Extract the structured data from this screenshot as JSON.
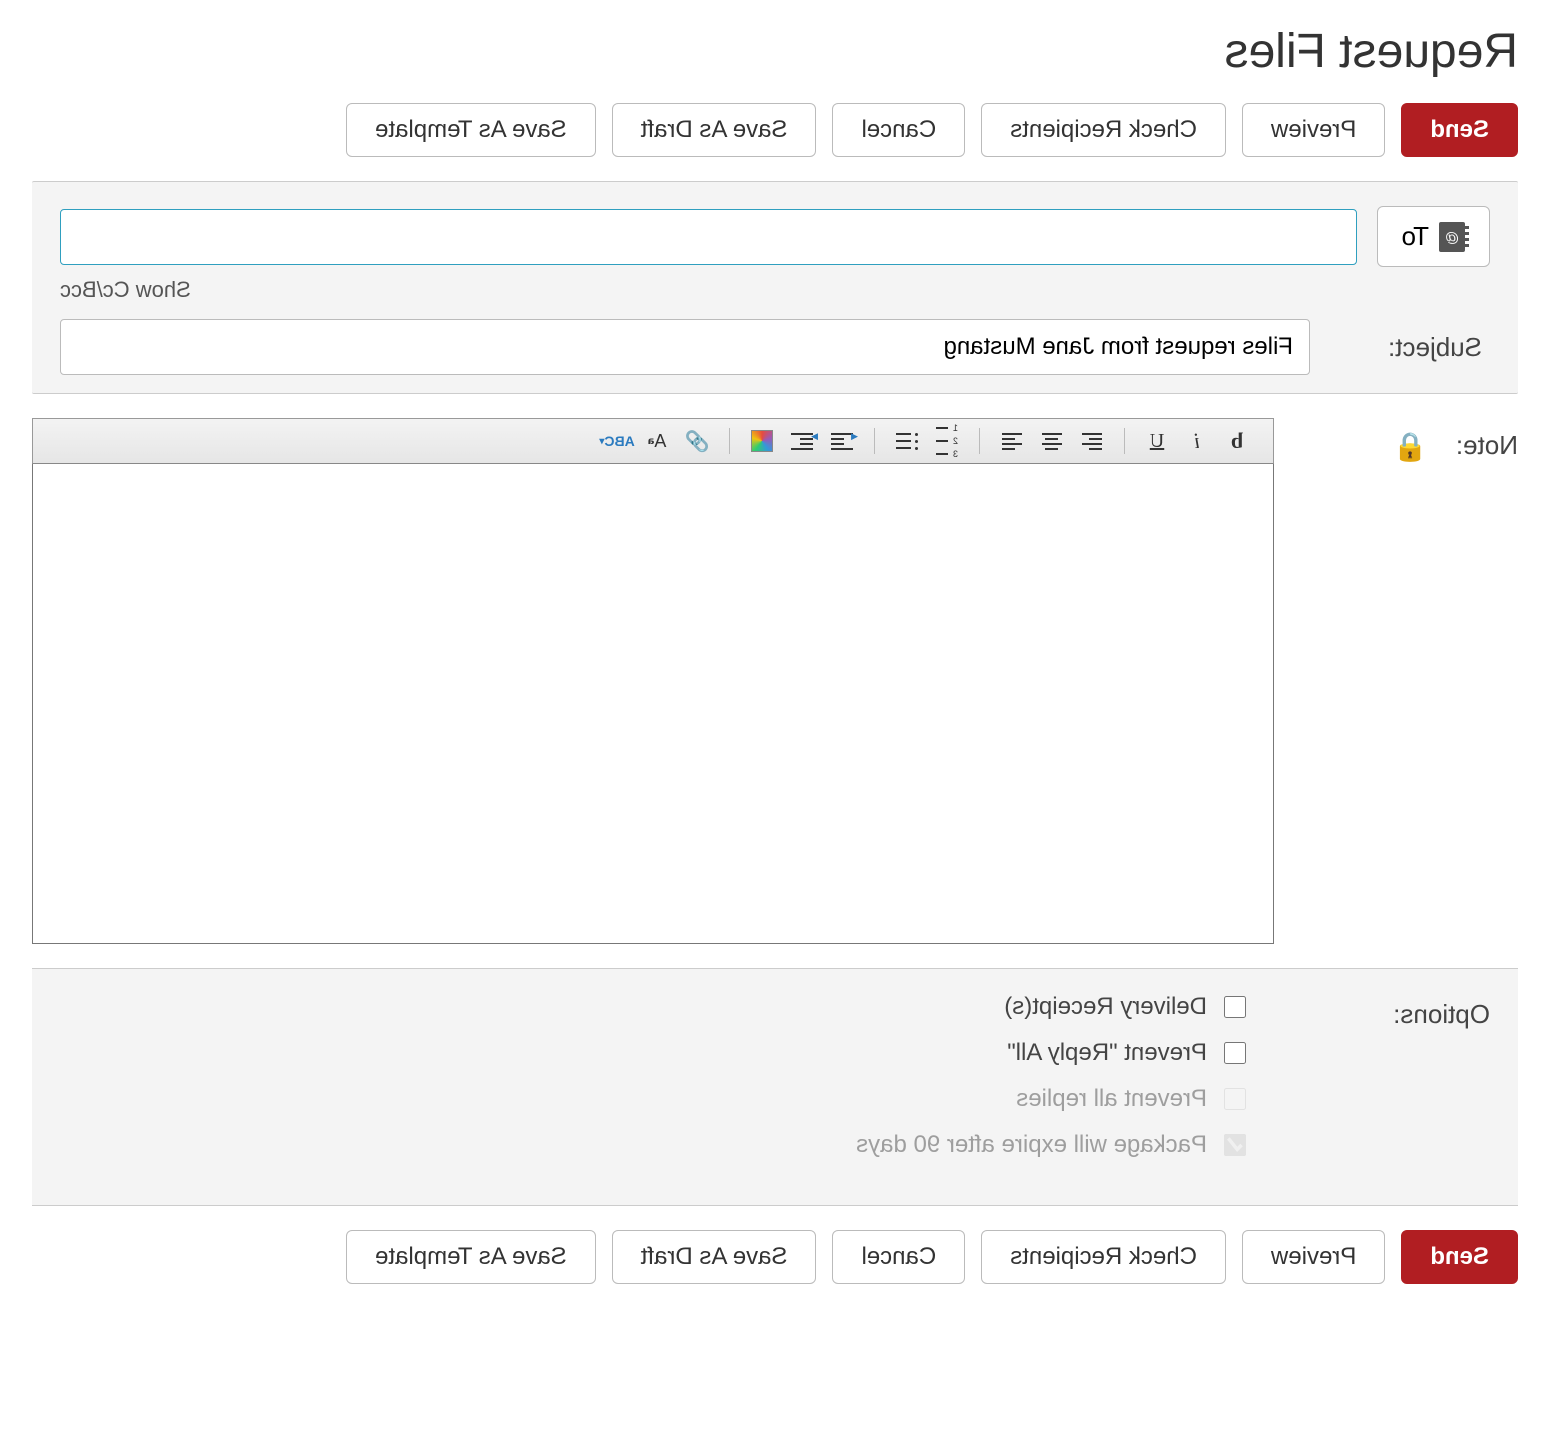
{
  "title": "Request Files",
  "buttons": {
    "send": "Send",
    "preview": "Preview",
    "check_recipients": "Check Recipients",
    "cancel": "Cancel",
    "save_draft": "Save As Draft",
    "save_template": "Save As Template"
  },
  "fields": {
    "to_button": "To",
    "to_value": "",
    "show_ccbcc": "Show Cc/Bcc",
    "subject_label": "Subject:",
    "subject_value": "Files request from Jane Mustang",
    "note_label": "Note:",
    "note_body": ""
  },
  "toolbar": {
    "bold": "b",
    "italic": "i",
    "underline": "U",
    "spell": "ABC"
  },
  "options": {
    "label": "Options:",
    "items": [
      {
        "label": "Delivery Receipt(s)",
        "checked": false,
        "disabled": false
      },
      {
        "label": "Prevent \"Reply All\"",
        "checked": false,
        "disabled": false
      },
      {
        "label": "Prevent all replies",
        "checked": false,
        "disabled": true
      },
      {
        "label": "Package will expire after 90 days",
        "checked": true,
        "disabled": true
      }
    ]
  }
}
